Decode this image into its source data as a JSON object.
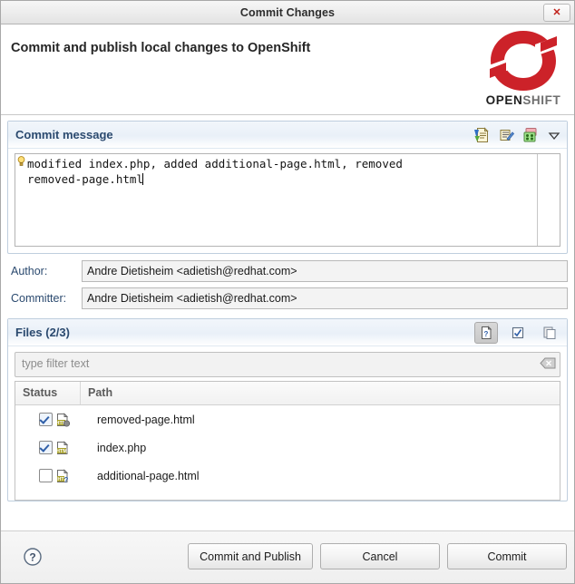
{
  "window": {
    "title": "Commit Changes",
    "close_label": "✕"
  },
  "banner": {
    "heading": "Commit and publish local changes to OpenShift",
    "logo": {
      "word_open": "OPEN",
      "word_shift": "SHIFT",
      "color": "#cc2229"
    }
  },
  "commit_message": {
    "section_title": "Commit message",
    "text": "modified index.php, added additional-page.html, removed\nremoved-page.html",
    "toolbar": [
      {
        "name": "spell-check-icon"
      },
      {
        "name": "signed-off-icon"
      },
      {
        "name": "amend-commit-icon"
      },
      {
        "name": "chevron-down-icon"
      }
    ]
  },
  "author": {
    "label": "Author:",
    "value": "Andre Dietisheim <adietish@redhat.com>"
  },
  "committer": {
    "label": "Committer:",
    "value": "Andre Dietisheim <adietish@redhat.com>"
  },
  "files": {
    "section_title": "Files (2/3)",
    "toolbar": [
      {
        "name": "show-untracked-files-icon",
        "pressed": true
      },
      {
        "name": "select-all-icon",
        "pressed": false
      },
      {
        "name": "copy-icon",
        "pressed": false
      }
    ],
    "filter": {
      "placeholder": "type filter text",
      "value": "",
      "clear_icon": "clear-filter-icon"
    },
    "columns": [
      "Status",
      "Path"
    ],
    "rows": [
      {
        "checked": true,
        "icon": "html-file-removed-icon",
        "path": "removed-page.html"
      },
      {
        "checked": true,
        "icon": "html-file-modified-icon",
        "path": "index.php"
      },
      {
        "checked": false,
        "icon": "html-file-added-icon",
        "path": "additional-page.html"
      }
    ]
  },
  "footer": {
    "help_icon": "help-icon",
    "buttons": [
      {
        "label": "Commit and Publish"
      },
      {
        "label": "Cancel"
      },
      {
        "label": "Commit"
      }
    ]
  }
}
